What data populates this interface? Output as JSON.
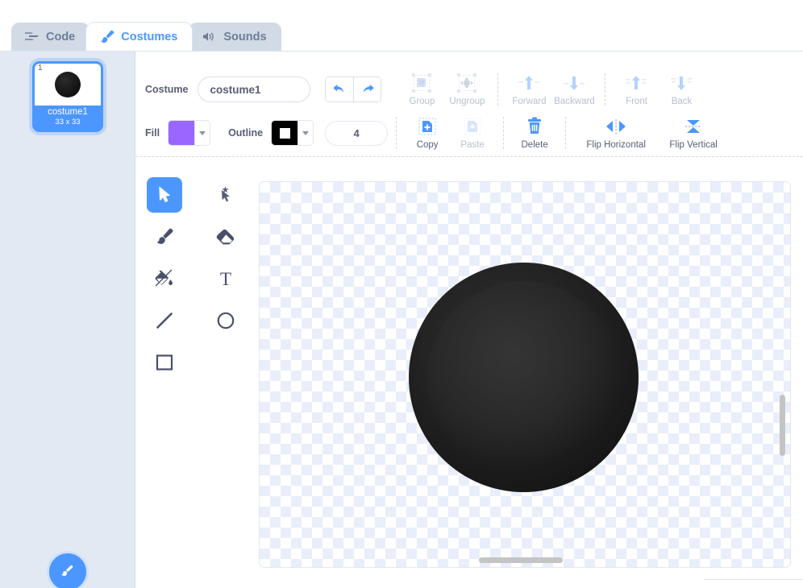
{
  "tabs": [
    {
      "id": "code",
      "label": "Code",
      "icon": "code-blocks-icon",
      "active": false
    },
    {
      "id": "costumes",
      "label": "Costumes",
      "icon": "paintbrush-icon",
      "active": true
    },
    {
      "id": "sounds",
      "label": "Sounds",
      "icon": "speaker-icon",
      "active": false
    }
  ],
  "sidebar": {
    "costumes": [
      {
        "index": "1",
        "name": "costume1",
        "size": "33 x 33"
      }
    ],
    "add_button_label": "Add Costume",
    "add_button_icon": "add-costume-icon"
  },
  "toolbar": {
    "costume_label": "Costume",
    "costume_name_value": "costume1",
    "costume_name_placeholder": "costume1",
    "undo_label": "Undo",
    "redo_label": "Redo",
    "fill_label": "Fill",
    "fill_color": "#9966FF",
    "outline_label": "Outline",
    "outline_color": "#000000",
    "stroke_width_value": "4",
    "stroke_width_placeholder": "4",
    "row1_actions": [
      {
        "id": "group",
        "label": "Group",
        "icon": "group-icon",
        "enabled": false
      },
      {
        "id": "ungroup",
        "label": "Ungroup",
        "icon": "ungroup-icon",
        "enabled": false
      },
      {
        "id": "forward",
        "label": "Forward",
        "icon": "forward-icon",
        "enabled": false
      },
      {
        "id": "backward",
        "label": "Backward",
        "icon": "backward-icon",
        "enabled": false
      },
      {
        "id": "front",
        "label": "Front",
        "icon": "front-icon",
        "enabled": false
      },
      {
        "id": "back",
        "label": "Back",
        "icon": "back-icon",
        "enabled": false
      }
    ],
    "row2_actions": [
      {
        "id": "copy",
        "label": "Copy",
        "icon": "copy-icon",
        "enabled": true
      },
      {
        "id": "paste",
        "label": "Paste",
        "icon": "paste-icon",
        "enabled": false
      },
      {
        "id": "delete",
        "label": "Delete",
        "icon": "trash-icon",
        "enabled": true
      },
      {
        "id": "flip-horizontal",
        "label": "Flip Horizontal",
        "icon": "flip-horizontal-icon",
        "enabled": true
      },
      {
        "id": "flip-vertical",
        "label": "Flip Vertical",
        "icon": "flip-vertical-icon",
        "enabled": true
      }
    ]
  },
  "palette": {
    "tools": [
      {
        "id": "select",
        "label": "Select",
        "icon": "cursor-arrow-icon",
        "active": true
      },
      {
        "id": "reshape",
        "label": "Reshape",
        "icon": "reshape-icon",
        "active": false
      },
      {
        "id": "brush",
        "label": "Brush",
        "icon": "paintbrush-icon",
        "active": false
      },
      {
        "id": "eraser",
        "label": "Eraser",
        "icon": "eraser-icon",
        "active": false
      },
      {
        "id": "fill",
        "label": "Fill",
        "icon": "paint-bucket-icon",
        "active": false
      },
      {
        "id": "text",
        "label": "Text",
        "icon": "text-icon",
        "active": false
      },
      {
        "id": "line",
        "label": "Line",
        "icon": "line-icon",
        "active": false
      },
      {
        "id": "circle",
        "label": "Circle",
        "icon": "circle-icon",
        "active": false
      },
      {
        "id": "rectangle",
        "label": "Rectangle",
        "icon": "rectangle-icon",
        "active": false
      }
    ]
  },
  "canvas": {
    "shape": "filled-circle",
    "shape_color": "#1b1b1b",
    "checker_color": "#E9EEFA",
    "vertical_scrollbar": "visible",
    "horizontal_scrollbar": "visible"
  },
  "colors": {
    "accent": "#4C97FF",
    "text": "#575E75",
    "disabled_text": "#B6BFD0",
    "sidebar_bg": "#E3E9F2",
    "tab_inactive_bg": "#D2DAE6"
  }
}
